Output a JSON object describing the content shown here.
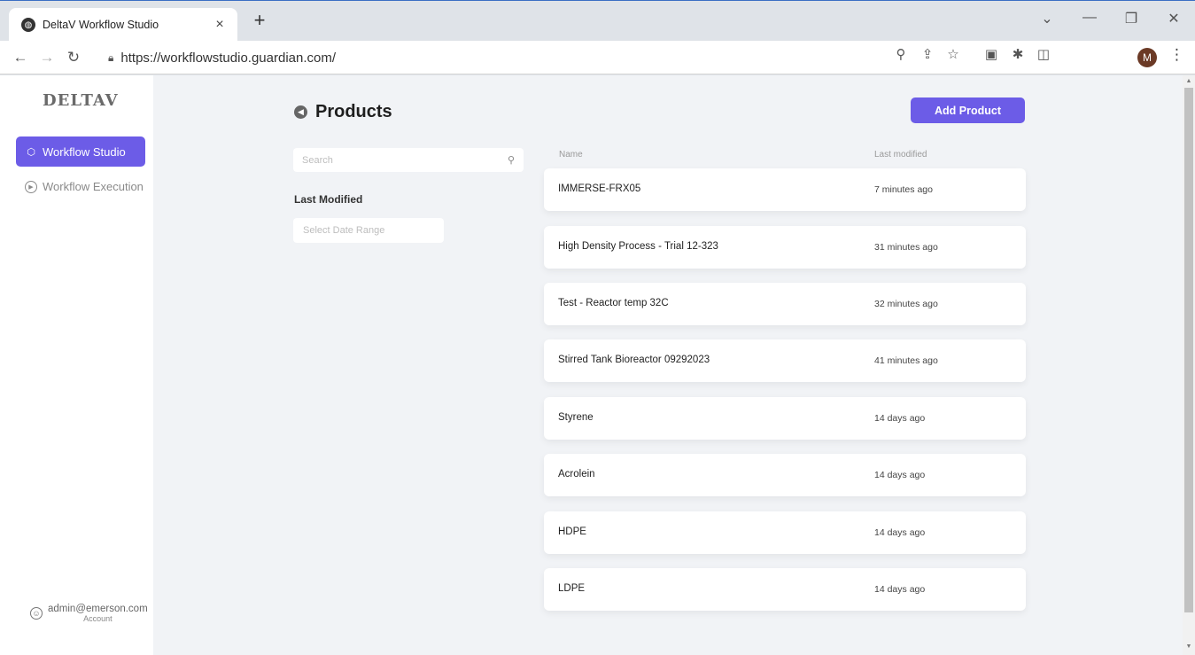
{
  "browser": {
    "tab_title": "DeltaV Workflow Studio",
    "tab_close": "×",
    "new_tab": "+",
    "url": "https://workflowstudio.guardian.com/",
    "profile_initial": "M",
    "controls": {
      "chevron": "⌄",
      "minimize": "—",
      "restore": "❐",
      "close": "✕"
    },
    "nav": {
      "back": "←",
      "forward": "→",
      "reload": "↻"
    },
    "toolbar_icons": [
      "zoom-icon",
      "share-icon",
      "star-icon",
      "extension-icon",
      "puzzle-icon",
      "sidepanel-icon"
    ]
  },
  "sidebar": {
    "logo": "DELTAV",
    "items": [
      {
        "label": "Workflow Studio",
        "active": true
      },
      {
        "label": "Workflow Execution",
        "active": false
      }
    ],
    "account": {
      "email": "admin@emerson.com",
      "label": "Account"
    }
  },
  "main": {
    "title": "Products",
    "add_button": "Add Product",
    "search": {
      "placeholder": "Search",
      "value": ""
    },
    "filter_label": "Last Modified",
    "date_range_placeholder": "Select Date Range",
    "columns": {
      "name": "Name",
      "modified": "Last modified"
    },
    "rows": [
      {
        "name": "IMMERSE-FRX05",
        "modified": "7 minutes ago"
      },
      {
        "name": "High Density Process - Trial 12-323",
        "modified": "31 minutes ago"
      },
      {
        "name": "Test - Reactor temp 32C",
        "modified": "32 minutes ago"
      },
      {
        "name": "Stirred Tank Bioreactor 09292023",
        "modified": "41 minutes ago"
      },
      {
        "name": "Styrene",
        "modified": "14 days ago"
      },
      {
        "name": "Acrolein",
        "modified": "14 days ago"
      },
      {
        "name": "HDPE",
        "modified": "14 days ago"
      },
      {
        "name": "LDPE",
        "modified": "14 days ago"
      }
    ]
  },
  "colors": {
    "accent": "#6c5ce7",
    "page_bg": "#f1f3f6",
    "card_bg": "#ffffff"
  }
}
